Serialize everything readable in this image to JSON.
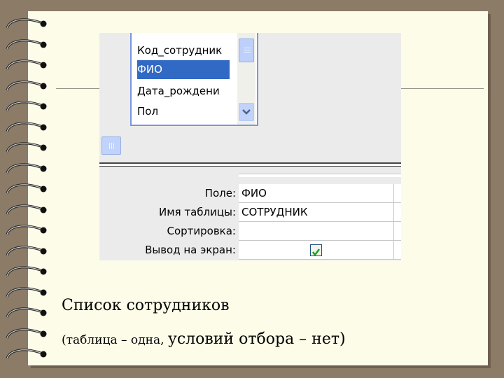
{
  "field_list": {
    "items": [
      {
        "label": "Код_сотрудник",
        "selected": false
      },
      {
        "label": "ФИО",
        "selected": true
      },
      {
        "label": "Дата_рождени",
        "selected": false
      },
      {
        "label": "Пол",
        "selected": false
      }
    ],
    "scroll_down_icon": "chevron-down-icon"
  },
  "query_grid": {
    "rows": [
      {
        "label": "Поле:",
        "value": "ФИО"
      },
      {
        "label": "Имя таблицы:",
        "value": "СОТРУДНИК"
      },
      {
        "label": "Сортировка:",
        "value": ""
      },
      {
        "label": "Вывод на экран:",
        "value": "",
        "checked": true
      }
    ]
  },
  "caption": {
    "title": "Список сотрудников",
    "subtitle_small": "(таблица – одна, ",
    "subtitle_large": "условий отбора – нет)"
  },
  "colors": {
    "selection": "#316ac5",
    "paper": "#fdfce9",
    "background": "#8b7b67",
    "check": "#21a121"
  }
}
